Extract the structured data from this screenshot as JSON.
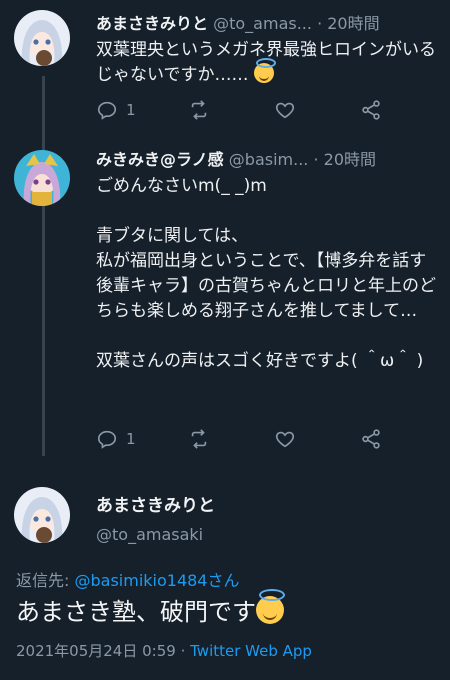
{
  "tweets": [
    {
      "name": "あまさきみりと",
      "handle": "@to_amas...",
      "dot": "·",
      "time": "20時間",
      "text": "双葉理央というメガネ界最強ヒロインがいるじゃないですか……",
      "emoji": "smiling-face-with-halo",
      "reply_count": "1",
      "retweet_count": "",
      "like_count": ""
    },
    {
      "name": "みきみき@ラノ感",
      "handle": "@basim...",
      "dot": "·",
      "time": "20時間",
      "text": "ごめんなさいm(_ _)m\n\n青ブタに関しては、\n私が福岡出身ということで、【博多弁を話す後輩キャラ】の古賀ちゃんとロリと年上のどちらも楽しめる翔子さんを推してまして…\n\n双葉さんの声はスゴく好きですよ( ＾ω＾ )",
      "reply_count": "1",
      "retweet_count": "",
      "like_count": ""
    }
  ],
  "main": {
    "name": "あまさきみりと",
    "handle": "@to_amasaki",
    "reply_prefix": "返信先: ",
    "reply_target": "@basimikio1484さん",
    "text": "あまさき塾、破門です",
    "emoji": "smiling-face-with-halo",
    "date": "2021年05月24日 0:59",
    "dot": " · ",
    "app": "Twitter Web App"
  },
  "icons": [
    "reply-icon",
    "retweet-icon",
    "like-icon",
    "share-icon"
  ],
  "colors": {
    "background": "#15202b",
    "accent": "#1d9bf0",
    "muted": "#8b98a5",
    "halo-emoji": "#ffcc4d"
  }
}
